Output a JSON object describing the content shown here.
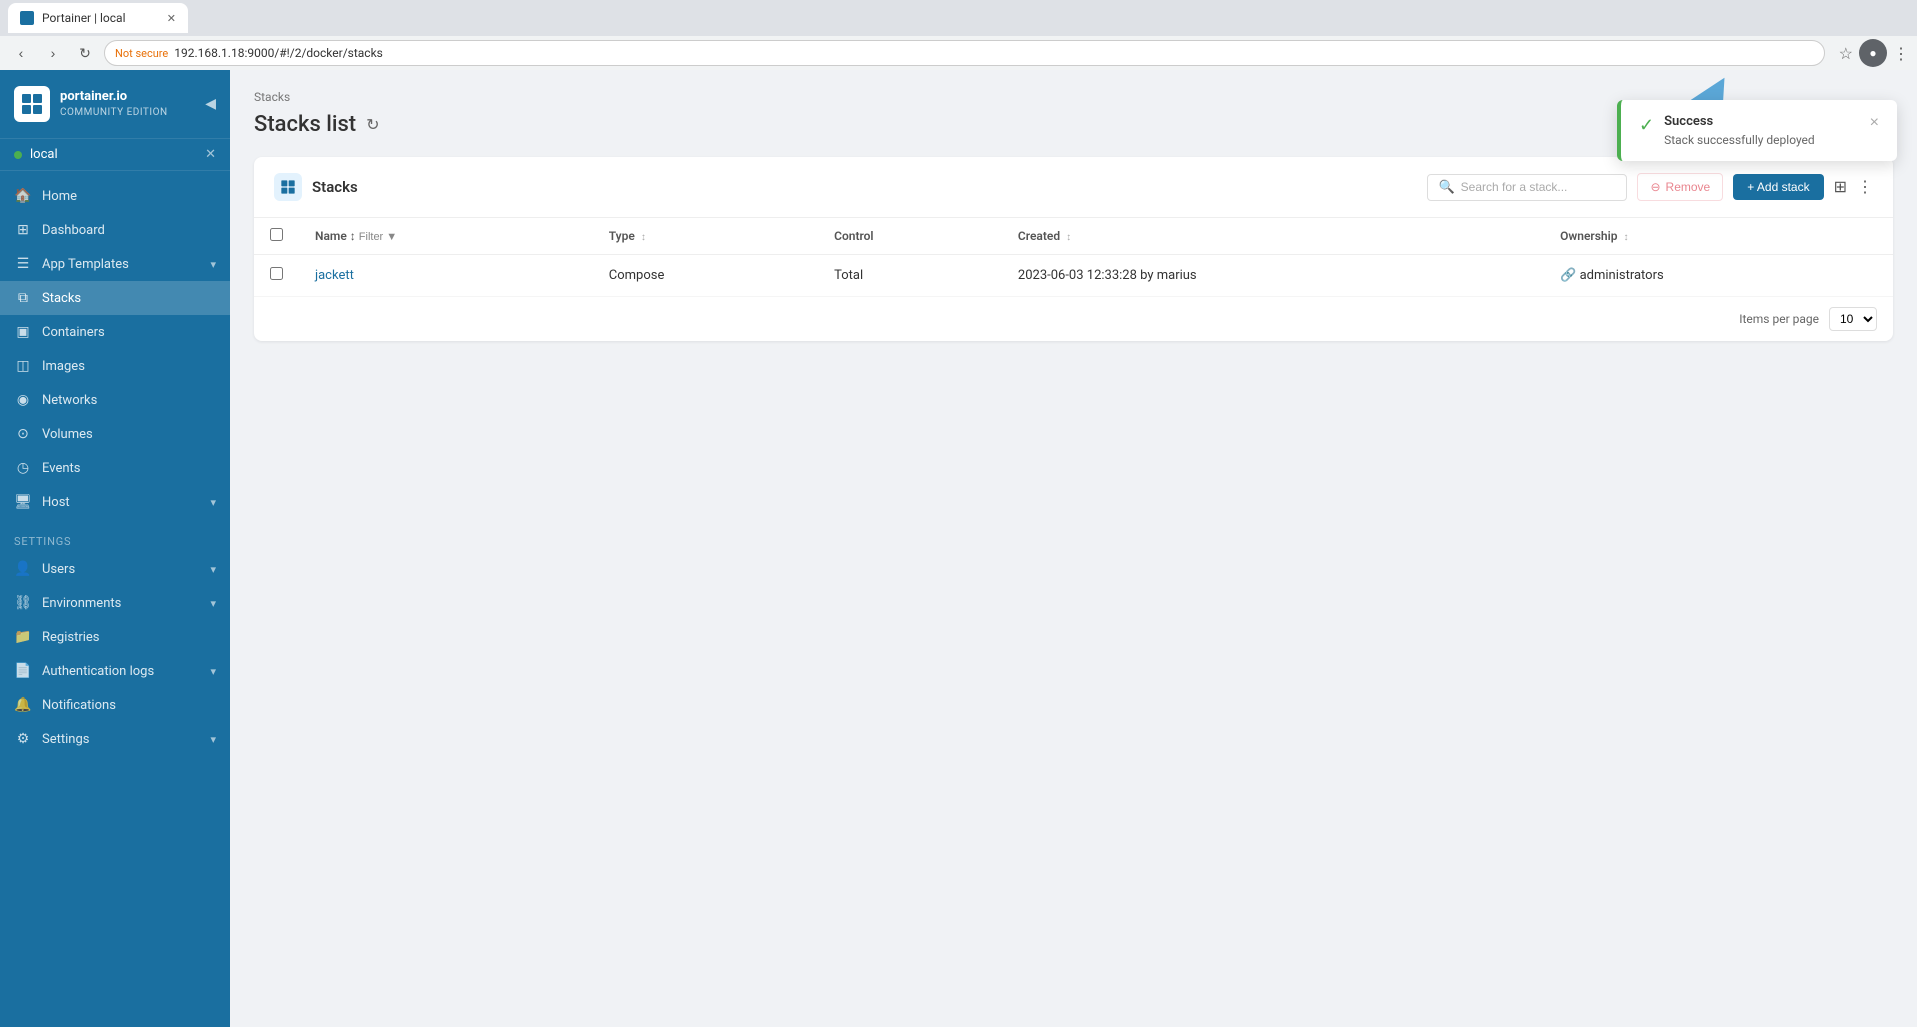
{
  "browser": {
    "tab_title": "Portainer | local",
    "url": "192.168.1.18:9000/#!/2/docker/stacks",
    "warning_text": "Not secure",
    "favicon_alt": "portainer-favicon"
  },
  "sidebar": {
    "logo": {
      "brand": "portainer.io",
      "edition": "Community Edition"
    },
    "endpoint": {
      "name": "local",
      "status": "connected"
    },
    "nav_items": [
      {
        "label": "Home",
        "icon": "🏠",
        "active": false
      },
      {
        "label": "Dashboard",
        "icon": "📊",
        "active": false
      },
      {
        "label": "App Templates",
        "icon": "📋",
        "active": false,
        "has_chevron": true
      },
      {
        "label": "Stacks",
        "icon": "🗂",
        "active": true
      },
      {
        "label": "Containers",
        "icon": "📦",
        "active": false
      },
      {
        "label": "Images",
        "icon": "🖼",
        "active": false
      },
      {
        "label": "Networks",
        "icon": "🌐",
        "active": false
      },
      {
        "label": "Volumes",
        "icon": "💾",
        "active": false
      },
      {
        "label": "Events",
        "icon": "📅",
        "active": false
      },
      {
        "label": "Host",
        "icon": "🖥",
        "active": false,
        "has_chevron": true
      }
    ],
    "settings_label": "Settings",
    "settings_items": [
      {
        "label": "Users",
        "icon": "👤",
        "has_chevron": true
      },
      {
        "label": "Environments",
        "icon": "🔗",
        "has_chevron": true
      },
      {
        "label": "Registries",
        "icon": "📁"
      },
      {
        "label": "Authentication logs",
        "icon": "📄",
        "has_chevron": true
      },
      {
        "label": "Notifications",
        "icon": "🔔"
      },
      {
        "label": "Settings",
        "icon": "⚙",
        "has_chevron": true
      }
    ]
  },
  "breadcrumb": "Stacks",
  "page_title": "Stacks list",
  "card": {
    "title": "Stacks",
    "search_placeholder": "Search for a stack...",
    "remove_label": "Remove",
    "add_label": "+ Add stack",
    "table": {
      "columns": [
        "Name",
        "Type",
        "Control",
        "Created",
        "Ownership"
      ],
      "rows": [
        {
          "name": "jackett",
          "type": "Compose",
          "control": "Total",
          "created": "2023-06-03 12:33:28 by marius",
          "ownership": "administrators"
        }
      ]
    },
    "items_per_page_label": "Items per page",
    "per_page_value": "10"
  },
  "toast": {
    "title": "Success",
    "message": "Stack successfully deployed",
    "icon": "✓",
    "close_label": "×"
  }
}
